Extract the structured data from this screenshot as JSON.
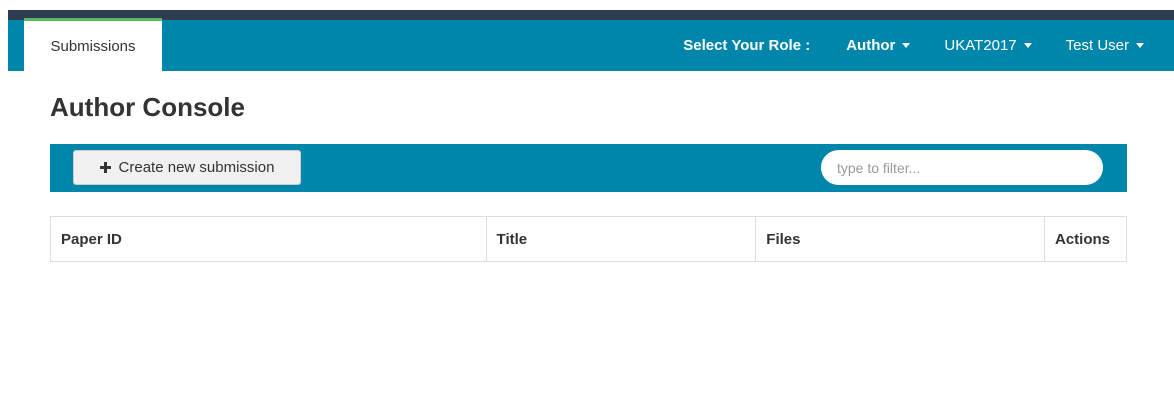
{
  "nav": {
    "tab_label": "Submissions",
    "role_label": "Select Your Role :",
    "role_value": "Author",
    "conference": "UKAT2017",
    "user": "Test User"
  },
  "page": {
    "title": "Author Console"
  },
  "toolbar": {
    "create_label": "Create new submission",
    "filter_placeholder": "type to filter..."
  },
  "table": {
    "columns": [
      "Paper ID",
      "Title",
      "Files",
      "Actions"
    ]
  },
  "colors": {
    "nav_bg": "#0086aa",
    "top_bar": "#2c3e50",
    "tab_accent": "#5cb85c"
  }
}
